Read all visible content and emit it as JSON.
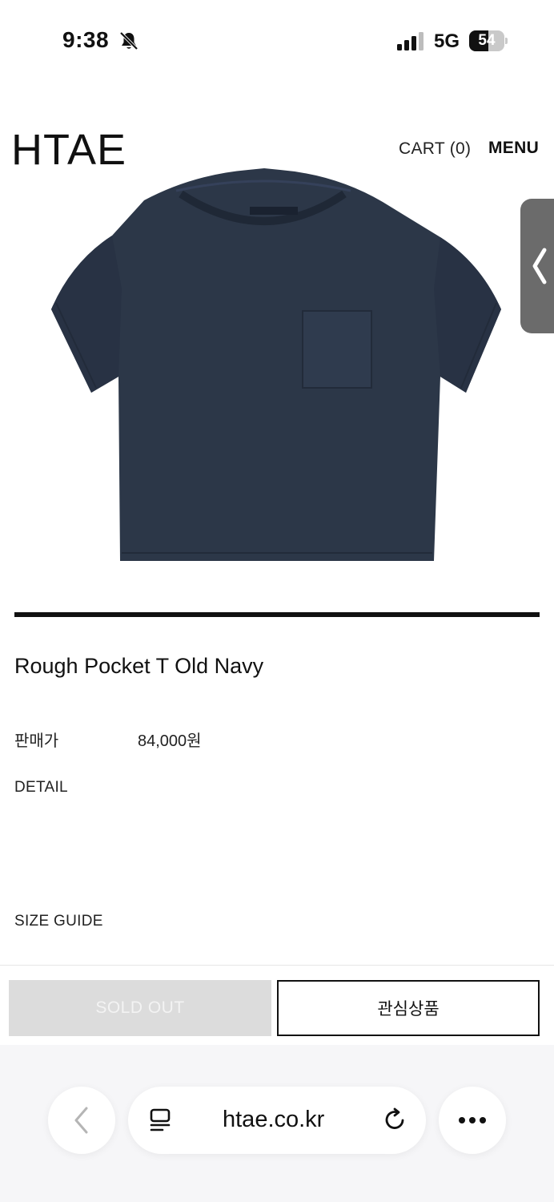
{
  "status_bar": {
    "time": "9:38",
    "network": "5G",
    "battery_level": "54",
    "battery_fraction": 0.54
  },
  "header": {
    "logo": "HTAE",
    "cart": "CART (0)",
    "menu": "MENU"
  },
  "product": {
    "image_icon": "navy-pocket-tshirt-photo",
    "name": "Rough Pocket T Old Navy",
    "price_label": "판매가",
    "price": "84,000원",
    "detail_label": "DETAIL",
    "size_guide_label": "SIZE GUIDE"
  },
  "actions": {
    "sold_out": "SOLD OUT",
    "wishlist": "관심상품"
  },
  "browser": {
    "url": "htae.co.kr",
    "icons": [
      "chevron-left-icon",
      "reader-icon",
      "reload-icon",
      "more-icon"
    ]
  },
  "colors": {
    "shirt": "#2c3748",
    "accent": "#111111",
    "sold_out_bg": "#dcdcdc"
  }
}
